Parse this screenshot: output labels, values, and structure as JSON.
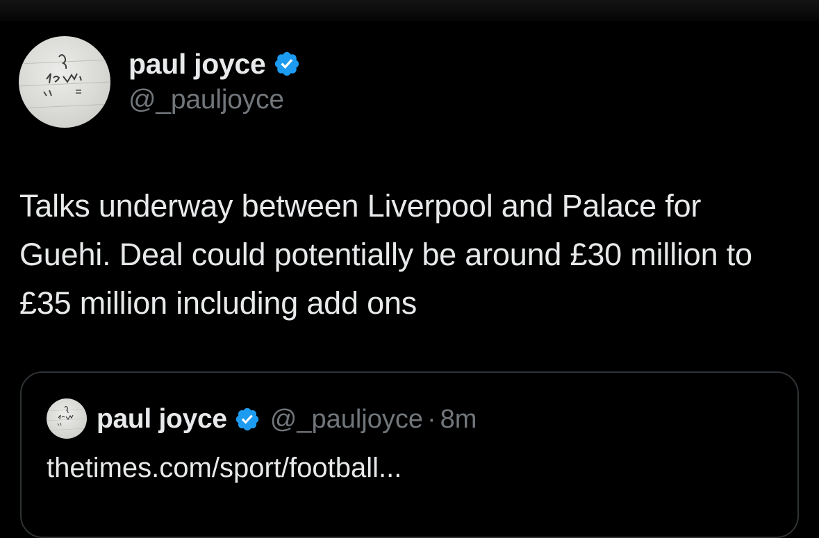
{
  "tweet": {
    "author": {
      "display_name": "paul joyce",
      "handle": "@_pauljoyce",
      "verified": true,
      "avatar_icon": "handwritten-note-avatar"
    },
    "text": "Talks underway between Liverpool and Palace for Guehi. Deal could potentially be around £30 million to £35 million including add ons",
    "quote": {
      "display_name": "paul joyce",
      "handle": "@_pauljoyce",
      "separator": "·",
      "time": "8m",
      "verified": true,
      "text": "thetimes.com/sport/football..."
    }
  },
  "colors": {
    "background": "#000000",
    "primary_text": "#e7e9ea",
    "secondary_text": "#71767b",
    "verified_badge": "#1d9bf0",
    "card_border": "#2f3336"
  }
}
